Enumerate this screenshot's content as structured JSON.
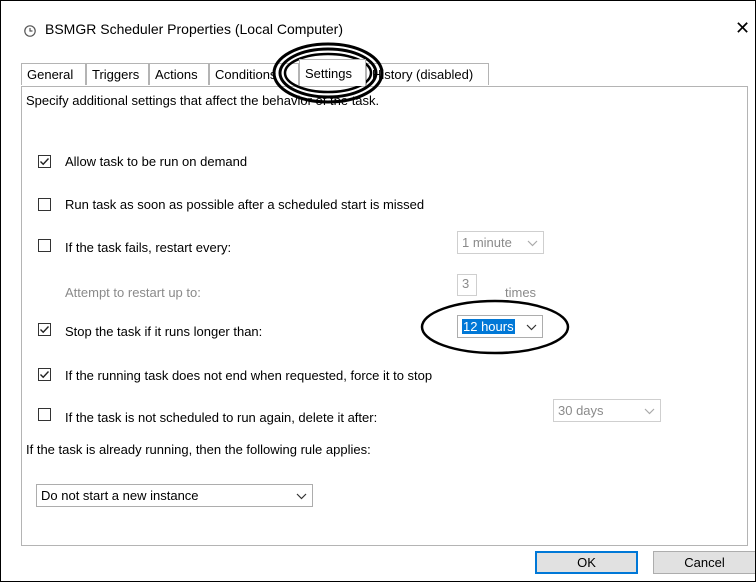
{
  "window": {
    "title": "BSMGR Scheduler Properties (Local Computer)",
    "close_glyph": "✕",
    "title_icon": "task-scheduler-icon"
  },
  "tabs": [
    {
      "label": "General"
    },
    {
      "label": "Triggers"
    },
    {
      "label": "Actions"
    },
    {
      "label": "Conditions"
    },
    {
      "label": "Settings",
      "active": true
    },
    {
      "label": "History (disabled)"
    }
  ],
  "settings": {
    "description": "Specify additional settings that affect the behavior of the task.",
    "allow_on_demand": {
      "label": "Allow task to be run on demand",
      "checked": true
    },
    "run_asap": {
      "label": "Run task as soon as possible after a scheduled start is missed",
      "checked": false
    },
    "restart_on_fail": {
      "label": "If the task fails, restart every:",
      "checked": false,
      "value": "1 minute"
    },
    "restart_attempts": {
      "label": "Attempt to restart up to:",
      "value": "3",
      "suffix": "times"
    },
    "stop_if_longer": {
      "label": "Stop the task if it runs longer than:",
      "checked": true,
      "value": "12 hours"
    },
    "force_stop": {
      "label": "If the running task does not end when requested, force it to stop",
      "checked": true
    },
    "delete_after": {
      "label": "If the task is not scheduled to run again, delete it after:",
      "checked": false,
      "value": "30 days"
    },
    "running_rule_label": "If the task is already running, then the following rule applies:",
    "running_rule_value": "Do not start a new instance"
  },
  "buttons": {
    "ok": "OK",
    "cancel": "Cancel"
  },
  "colors": {
    "selection": "#0078d7",
    "annotation": "#000000"
  }
}
